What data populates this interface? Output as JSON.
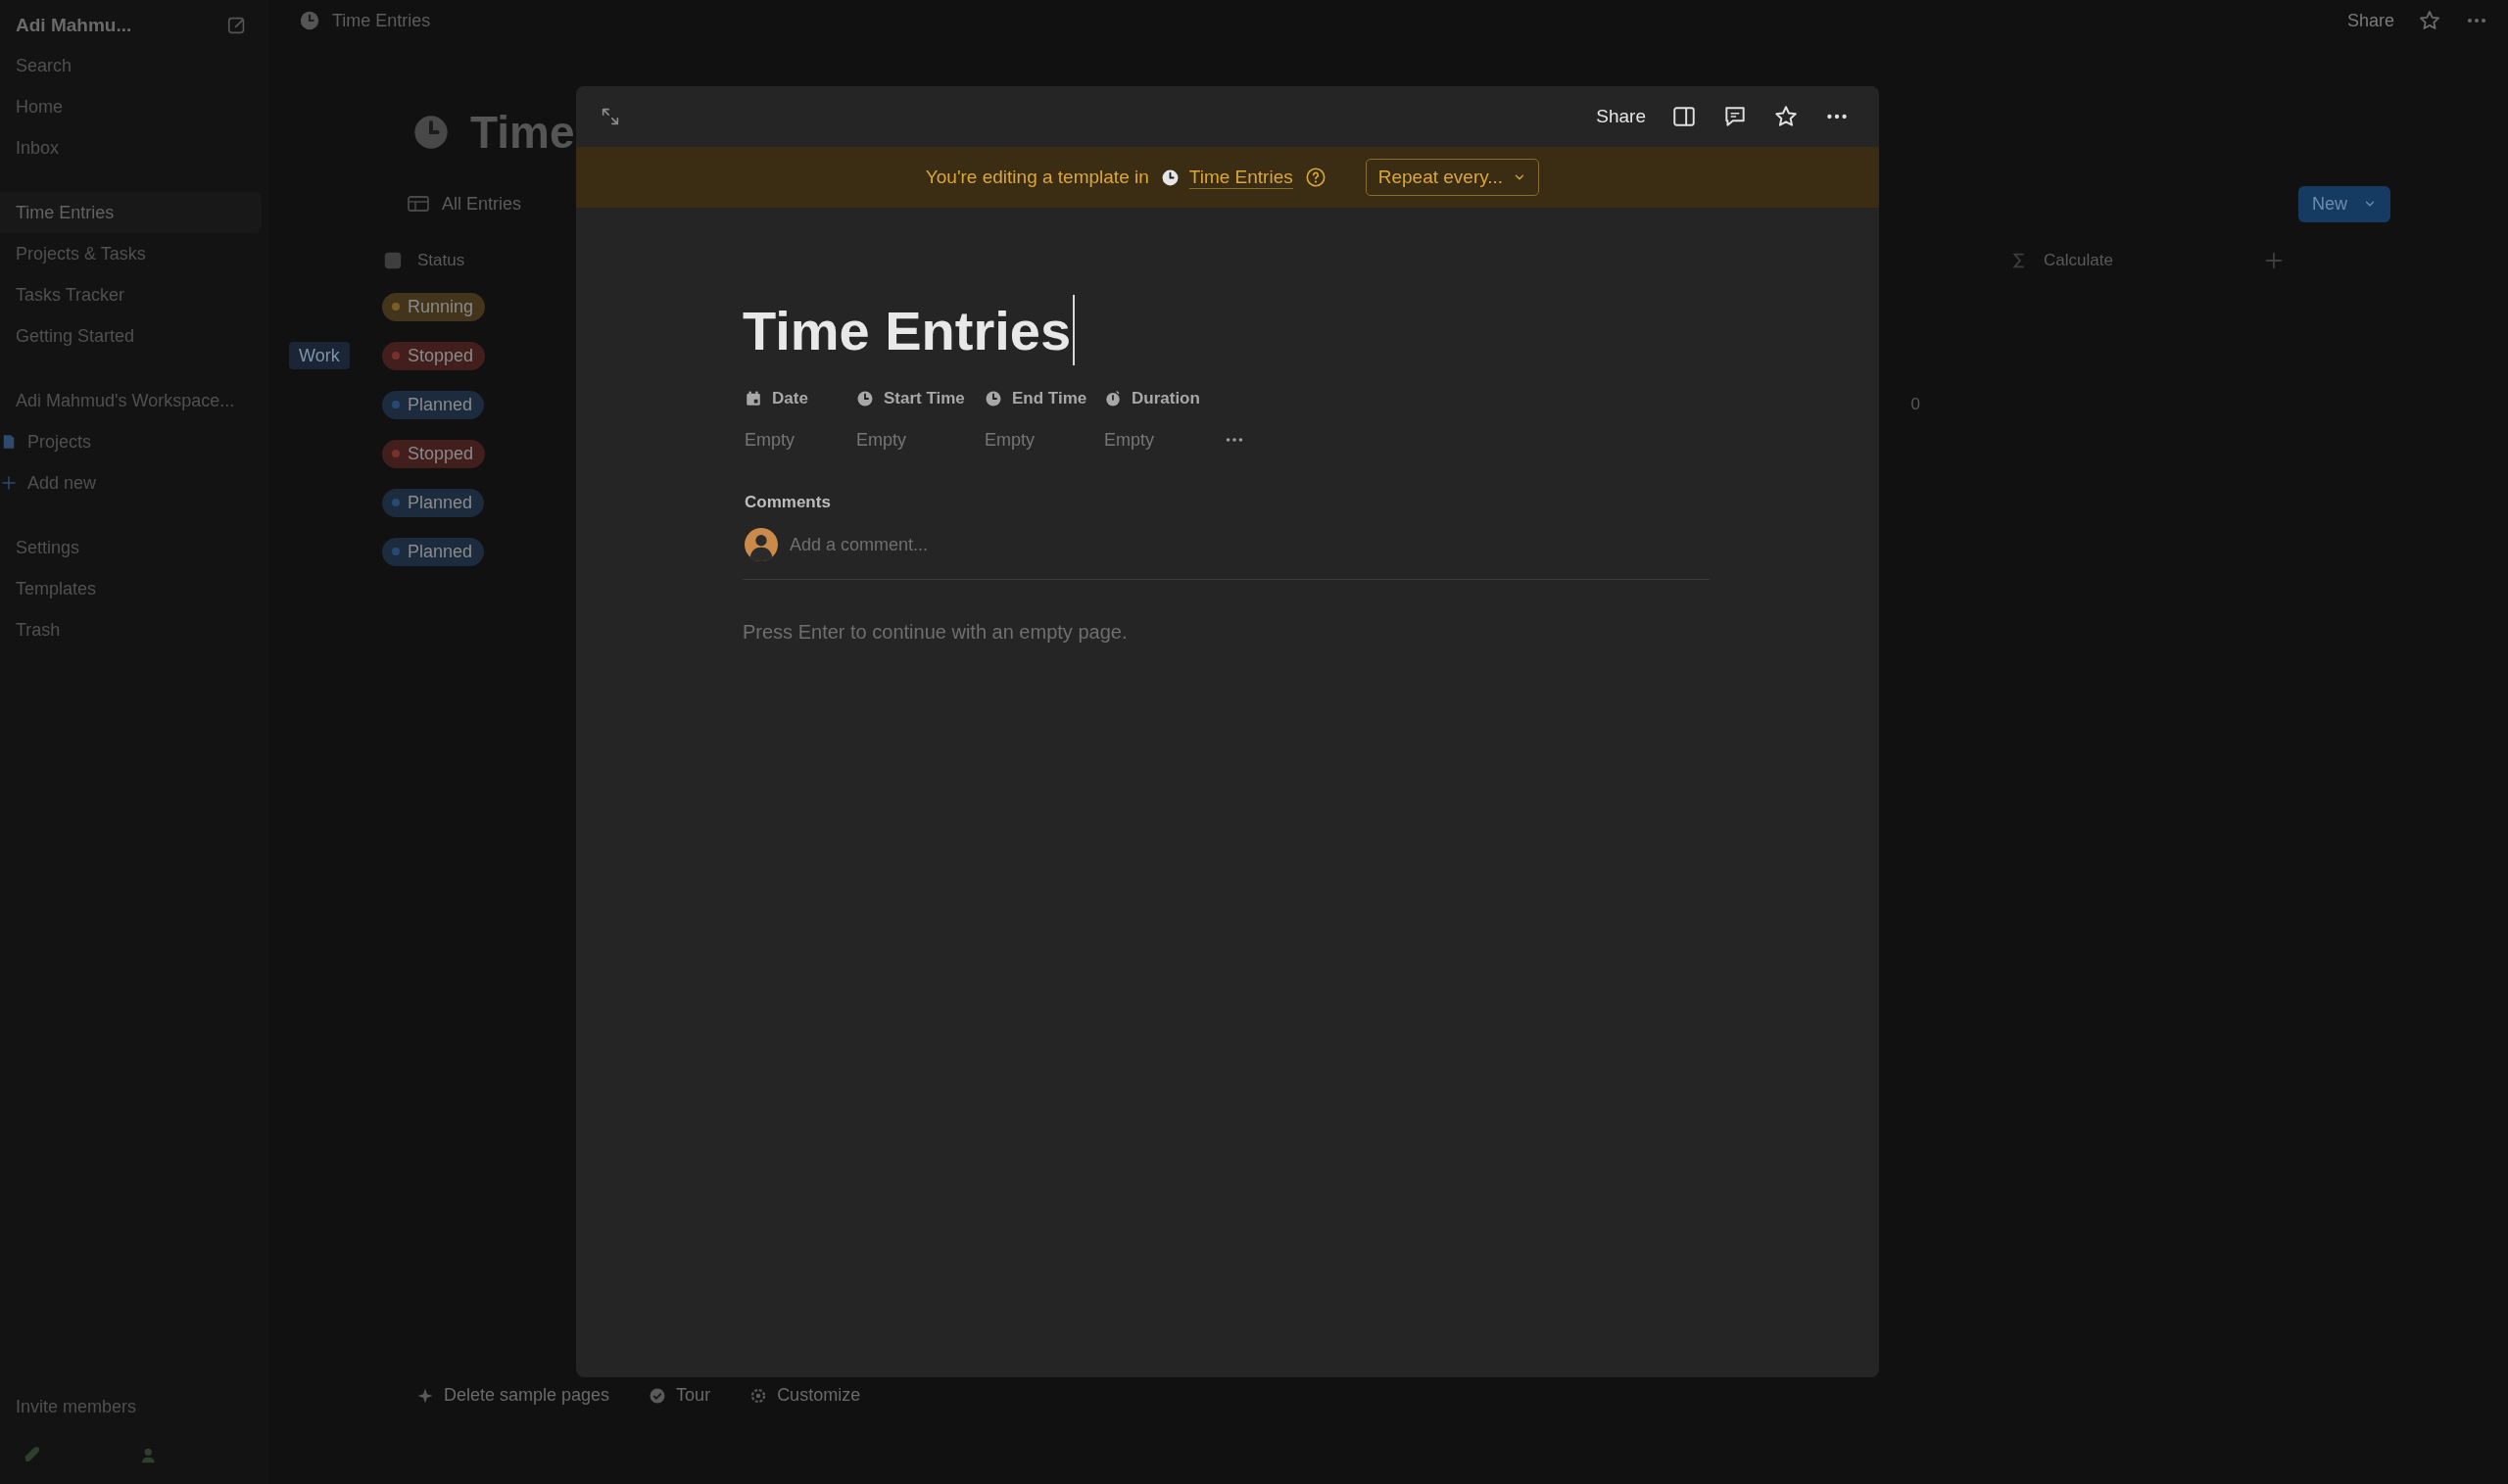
{
  "sidebar": {
    "workspace": "Adi Mahmu...",
    "nav": [
      "Search",
      "Home",
      "Inbox"
    ],
    "pages": [
      {
        "label": "Time Entries",
        "selected": true
      },
      {
        "label": "Projects & Tasks",
        "selected": false
      },
      {
        "label": "Tasks Tracker",
        "selected": false
      },
      {
        "label": "Getting Started",
        "selected": false
      }
    ],
    "workspace_name": "Adi Mahmud's Workspace...",
    "workspace_items": [
      {
        "label": "Projects",
        "kind": "page"
      },
      {
        "label": "Add new",
        "kind": "add"
      }
    ],
    "footer": [
      "Settings",
      "Templates",
      "Trash"
    ],
    "invite": "Invite members"
  },
  "topbar": {
    "breadcrumb": "Time Entries",
    "share": "Share"
  },
  "database": {
    "title": "Time",
    "view": "All Entries",
    "status_column": "Status",
    "calculate": "Calculate",
    "new_button": "New",
    "rows": [
      {
        "status": "Running",
        "color": "#7a5e26"
      },
      {
        "status": "Stopped",
        "color": "#7a302b",
        "tag": "Work"
      },
      {
        "status": "Planned",
        "color": "#284a72",
        "number": "0"
      },
      {
        "status": "Stopped",
        "color": "#7a302b"
      },
      {
        "status": "Planned",
        "color": "#284a72"
      },
      {
        "status": "Planned",
        "color": "#284a72"
      }
    ],
    "footer_actions": [
      {
        "label": "Delete sample pages",
        "kind": "sparkle"
      },
      {
        "label": "Tour",
        "kind": "check"
      },
      {
        "label": "Customize",
        "kind": "gear"
      }
    ]
  },
  "modal": {
    "share": "Share",
    "banner": {
      "text": "You're editing a template in",
      "link": "Time Entries",
      "repeat": "Repeat every..."
    },
    "title": "Time Entries",
    "properties": [
      {
        "name": "Date",
        "kind": "date",
        "value": "Empty"
      },
      {
        "name": "Start Time",
        "kind": "time",
        "value": "Empty"
      },
      {
        "name": "End Time",
        "kind": "time",
        "value": "Empty"
      },
      {
        "name": "Duration",
        "kind": "duration",
        "value": "Empty"
      }
    ],
    "comments_label": "Comments",
    "comment_placeholder": "Add a comment...",
    "hint": "Press Enter to continue with an empty page."
  }
}
